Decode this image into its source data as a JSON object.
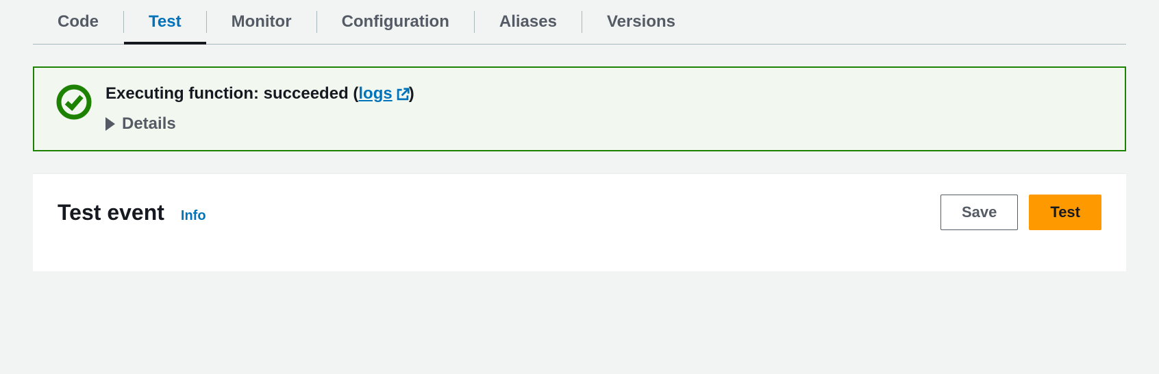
{
  "tabs": [
    {
      "label": "Code",
      "active": false
    },
    {
      "label": "Test",
      "active": true
    },
    {
      "label": "Monitor",
      "active": false
    },
    {
      "label": "Configuration",
      "active": false
    },
    {
      "label": "Aliases",
      "active": false
    },
    {
      "label": "Versions",
      "active": false
    }
  ],
  "alert": {
    "title_prefix": "Executing function: succeeded (",
    "logs_label": "logs ",
    "title_suffix": ")",
    "details_label": "Details"
  },
  "panel": {
    "title": "Test event",
    "info_label": "Info",
    "save_label": "Save",
    "test_label": "Test"
  }
}
